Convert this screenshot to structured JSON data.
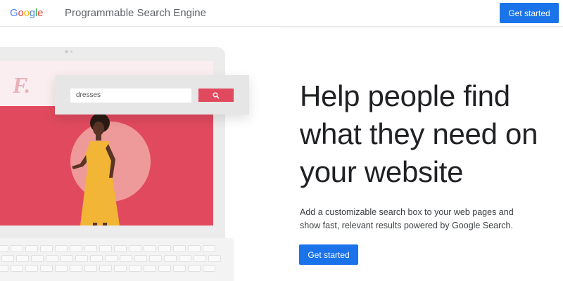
{
  "header": {
    "logo_text": "Google",
    "product_name": "Programmable Search Engine",
    "cta_label": "Get started"
  },
  "illustration": {
    "brand_letter": "F.",
    "search_value": "dresses",
    "search_icon": "search-icon"
  },
  "hero": {
    "headline": "Help people find what they need on your website",
    "subtext": "Add a customizable search box to your web pages and show fast, relevant results powered by Google Search.",
    "cta_label": "Get started"
  },
  "colors": {
    "primary_blue": "#1a73e8",
    "accent_red": "#e14a5e",
    "google_blue": "#4285f4",
    "google_red": "#ea4335",
    "google_yellow": "#fbbc05",
    "google_green": "#34a853"
  }
}
